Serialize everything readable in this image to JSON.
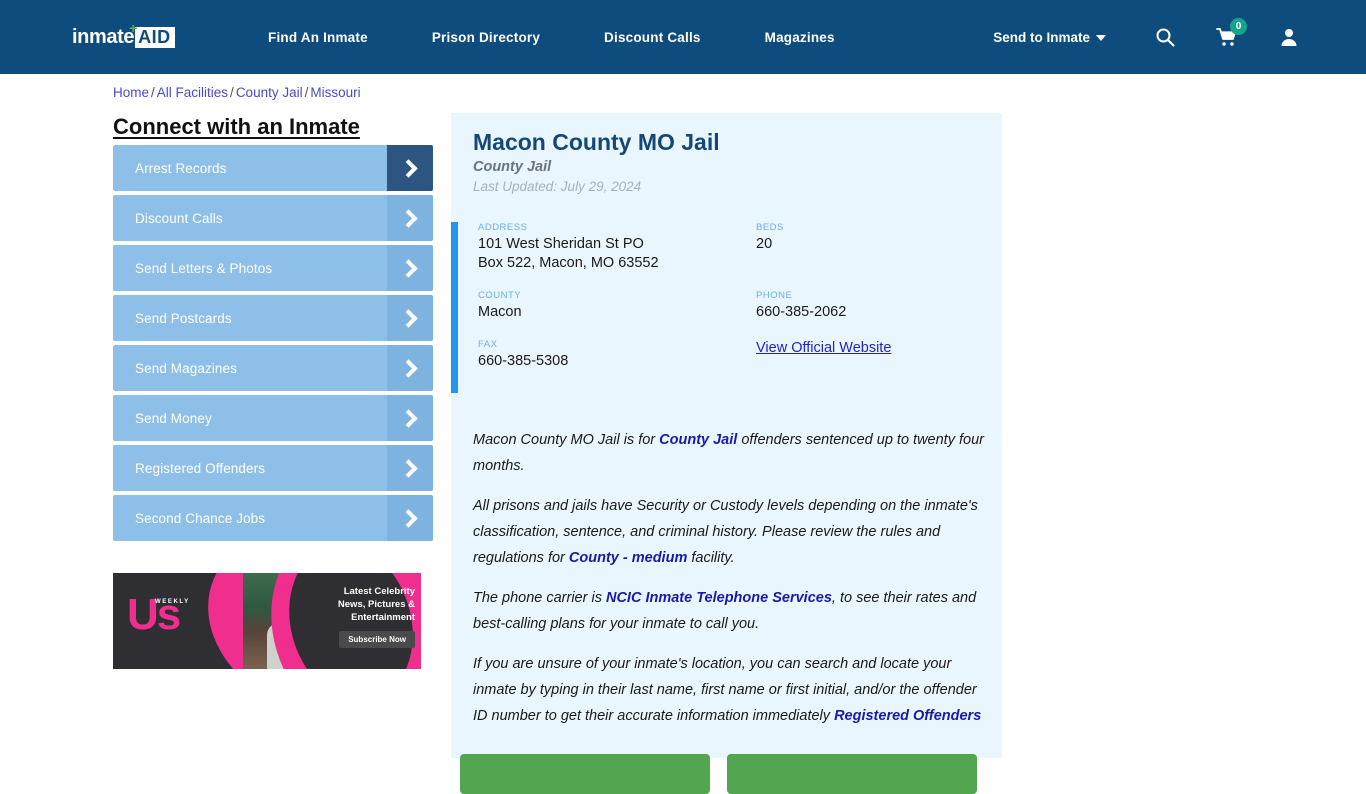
{
  "header": {
    "logo": {
      "primary": "inmate",
      "boxed": "AID",
      "plus_icon": "plus-icon"
    },
    "nav_items": [
      {
        "label": "Find An Inmate"
      },
      {
        "label": "Prison Directory"
      },
      {
        "label": "Discount Calls"
      },
      {
        "label": "Magazines"
      }
    ],
    "send_to_inmate": "Send to Inmate",
    "icons": {
      "search": "search-icon",
      "cart": "cart-icon",
      "account": "user-icon"
    },
    "cart_count": "0",
    "colors": {
      "nav_bg": "#0d4c7c",
      "badge": "#17a589"
    }
  },
  "breadcrumb": {
    "items": [
      "Home",
      "All Facilities",
      "County Jail",
      "Missouri"
    ],
    "separator": "/"
  },
  "sidebar": {
    "title": "Connect with an Inmate",
    "items": [
      {
        "label": "Arrest Records",
        "active": true
      },
      {
        "label": "Discount Calls",
        "active": false
      },
      {
        "label": "Send Letters & Photos",
        "active": false
      },
      {
        "label": "Send Postcards",
        "active": false
      },
      {
        "label": "Send Magazines",
        "active": false
      },
      {
        "label": "Send Money",
        "active": false
      },
      {
        "label": "Registered Offenders",
        "active": false
      },
      {
        "label": "Second Chance Jobs",
        "active": false
      }
    ],
    "ad": {
      "brand": "Us",
      "brand_sub": "WEEKLY",
      "line1": "Latest Celebrity",
      "line2": "News, Pictures &",
      "line3": "Entertainment",
      "cta": "Subscribe Now"
    }
  },
  "facility": {
    "name": "Macon County MO Jail",
    "type": "County Jail",
    "last_updated": "Last Updated: July 29, 2024",
    "fields": {
      "address_label": "ADDRESS",
      "address_line1": "101 West Sheridan St PO",
      "address_line2": "Box 522, Macon, MO 63552",
      "beds_label": "BEDS",
      "beds_value": "20",
      "county_label": "COUNTY",
      "county_value": "Macon",
      "phone_label": "PHONE",
      "phone_value": "660-385-2062",
      "fax_label": "FAX",
      "fax_value": "660-385-5308",
      "website_link": "View Official Website"
    },
    "paragraphs": {
      "p1_a": "Macon County MO Jail is for ",
      "p1_b": "County Jail",
      "p1_c": " offenders sentenced up to twenty four months.",
      "p2_a": "All prisons and jails have Security or Custody levels depending on the inmate's classification, sentence, and criminal history. Please review the rules and regulations for ",
      "p2_b": "County - medium",
      "p2_c": " facility.",
      "p3_a": "The phone carrier is ",
      "p3_b": "NCIC Inmate Telephone Services",
      "p3_c": ", to see their rates and best-calling plans for your inmate to call you.",
      "p4_a": "If you are unsure of your inmate's location, you can search and locate your inmate by typing in their last name, first name or first initial, and/or the offender ID number to get their accurate information immediately ",
      "p4_b": "Registered Offenders"
    },
    "actions": [
      {
        "label": ""
      },
      {
        "label": ""
      }
    ]
  },
  "colors": {
    "card_bg": "#eaf6fd",
    "accent_bar": "#2196f3",
    "title": "#14487c",
    "sidebar_btn": "#8ebfe8",
    "sidebar_btn_arrow": "#7eb3e0",
    "sidebar_btn_arrow_active": "#2d5582",
    "green_button": "#52a650",
    "link": "#2222cc"
  }
}
